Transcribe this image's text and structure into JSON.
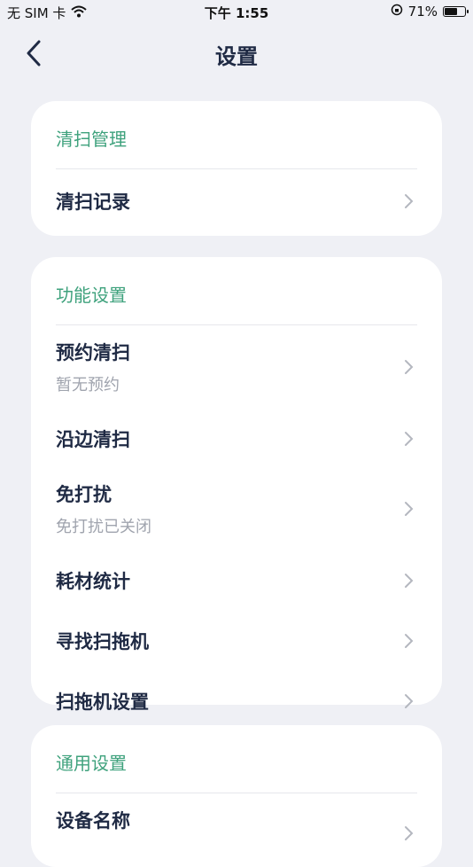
{
  "status_bar": {
    "carrier": "无 SIM 卡",
    "time": "下午 1:55",
    "battery_text": "71%",
    "battery_level": 0.71
  },
  "nav": {
    "title": "设置"
  },
  "sections": [
    {
      "title": "清扫管理",
      "items": [
        {
          "label": "清扫记录"
        }
      ]
    },
    {
      "title": "功能设置",
      "items": [
        {
          "label": "预约清扫",
          "sub": "暂无预约"
        },
        {
          "label": "沿边清扫"
        },
        {
          "label": "免打扰",
          "sub": "免打扰已关闭"
        },
        {
          "label": "耗材统计"
        },
        {
          "label": "寻找扫拖机"
        },
        {
          "label": "扫拖机设置"
        }
      ]
    },
    {
      "title": "通用设置",
      "items": [
        {
          "label": "设备名称"
        }
      ]
    }
  ],
  "colors": {
    "accent": "#3fa27d",
    "background": "#eff0f5",
    "text": "#1f2a44",
    "subtext": "#a0a4ae"
  }
}
